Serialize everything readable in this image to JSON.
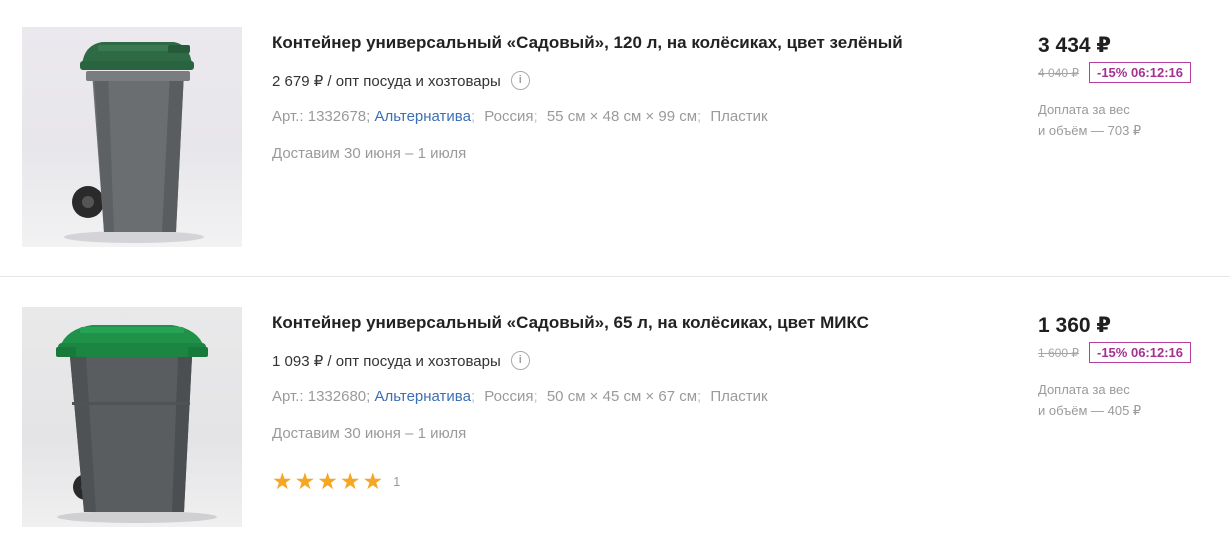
{
  "products": [
    {
      "image_alt": "Контейнер 120 л",
      "title": "Контейнер универсальный «Садовый», 120 л, на колёсиках, цвет зелёный",
      "wholesale": "2 679 ₽ / опт посуда и хозтовары",
      "article": "Арт.: 1332678;",
      "brand": "Альтернатива",
      "country": "Россия",
      "dimensions": "55 см × 48 см × 99 см",
      "material": "Пластик",
      "delivery": "Доставим 30 июня – 1 июля",
      "price": "3 434 ₽",
      "old_price": "4 040 ₽",
      "discount": "-15% 06:12:16",
      "surcharge_line1": "Доплата за вес",
      "surcharge_line2": "и объём — 703 ₽",
      "lid_color": "#2e6b45",
      "body_color": "#6a6d6f"
    },
    {
      "image_alt": "Контейнер 65 л",
      "title": "Контейнер универсальный «Садовый», 65 л, на колёсиках, цвет МИКС",
      "wholesale": "1 093 ₽ / опт посуда и хозтовары",
      "article": "Арт.: 1332680;",
      "brand": "Альтернатива",
      "country": "Россия",
      "dimensions": "50 см × 45 см × 67 см",
      "material": "Пластик",
      "delivery": "Доставим 30 июня – 1 июля",
      "rating_stars": 5,
      "rating_count": "1",
      "price": "1 360 ₽",
      "old_price": "1 600 ₽",
      "discount": "-15% 06:12:16",
      "surcharge_line1": "Доплата за вес",
      "surcharge_line2": "и объём — 405 ₽",
      "lid_color": "#1f9148",
      "body_color": "#595d5f"
    }
  ],
  "icons": {
    "info": "i",
    "star": "★"
  }
}
